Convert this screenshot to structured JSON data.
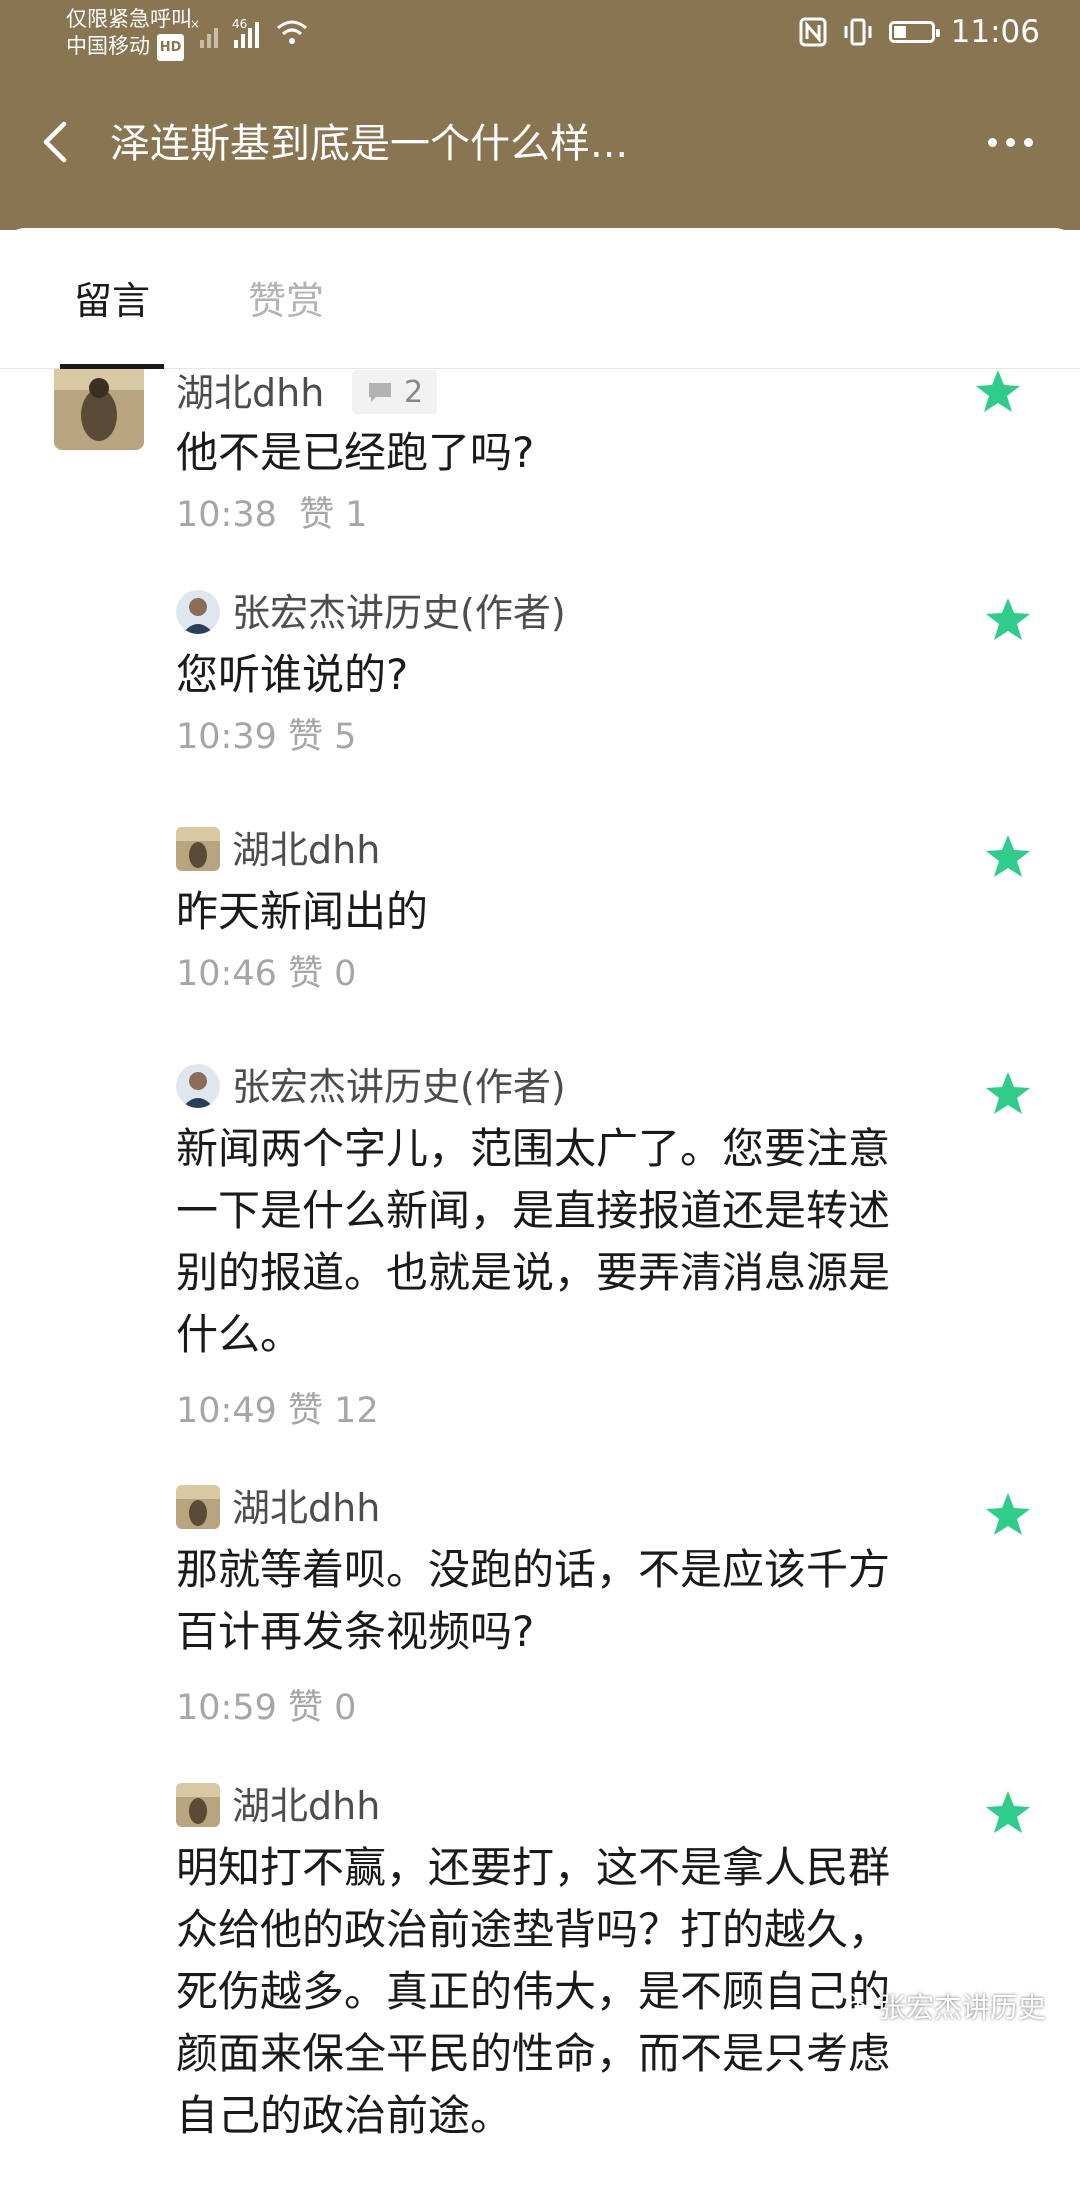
{
  "status_bar": {
    "carrier_line1": "仅限紧急呼叫",
    "carrier_line2": "中国移动",
    "hd_badge": "HD",
    "network": "46",
    "time": "11:06",
    "battery_level": 0.3
  },
  "header": {
    "title": "泽连斯基到底是一个什么样..."
  },
  "tabs": [
    {
      "label": "留言",
      "active": true
    },
    {
      "label": "赞赏",
      "active": false
    }
  ],
  "comments": [
    {
      "nickname": "湖北dhh",
      "reply_count": "2",
      "content": "他不是已经跑了吗?",
      "time": "10:38",
      "likes": "赞 1",
      "featured": true
    },
    {
      "nickname": "张宏杰讲历史(作者)",
      "content": "您听谁说的?",
      "time": "10:39",
      "likes": "赞 5",
      "featured": true
    },
    {
      "nickname": "湖北dhh",
      "content": "昨天新闻出的",
      "time": "10:46",
      "likes": "赞 0",
      "featured": true
    },
    {
      "nickname": "张宏杰讲历史(作者)",
      "content": "新闻两个字儿，范围太广了。您要注意一下是什么新闻，是直接报道还是转述别的报道。也就是说，要弄清消息源是什么。",
      "time": "10:49",
      "likes": "赞 12",
      "featured": true
    },
    {
      "nickname": "湖北dhh",
      "content": "那就等着呗。没跑的话，不是应该千方百计再发条视频吗?",
      "time": "10:59",
      "likes": "赞 0",
      "featured": true
    },
    {
      "nickname": "湖北dhh",
      "content": "明知打不赢，还要打，这不是拿人民群众给他的政治前途垫背吗？打的越久，死伤越多。真正的伟大，是不顾自己的颜面来保全平民的性命，而不是只考虑自己的政治前途。",
      "featured": true
    }
  ],
  "watermark": "张宏杰讲历史",
  "colors": {
    "header_bg": "#8a7553",
    "star": "#2fcc8b",
    "meta": "#a6a6a6"
  }
}
